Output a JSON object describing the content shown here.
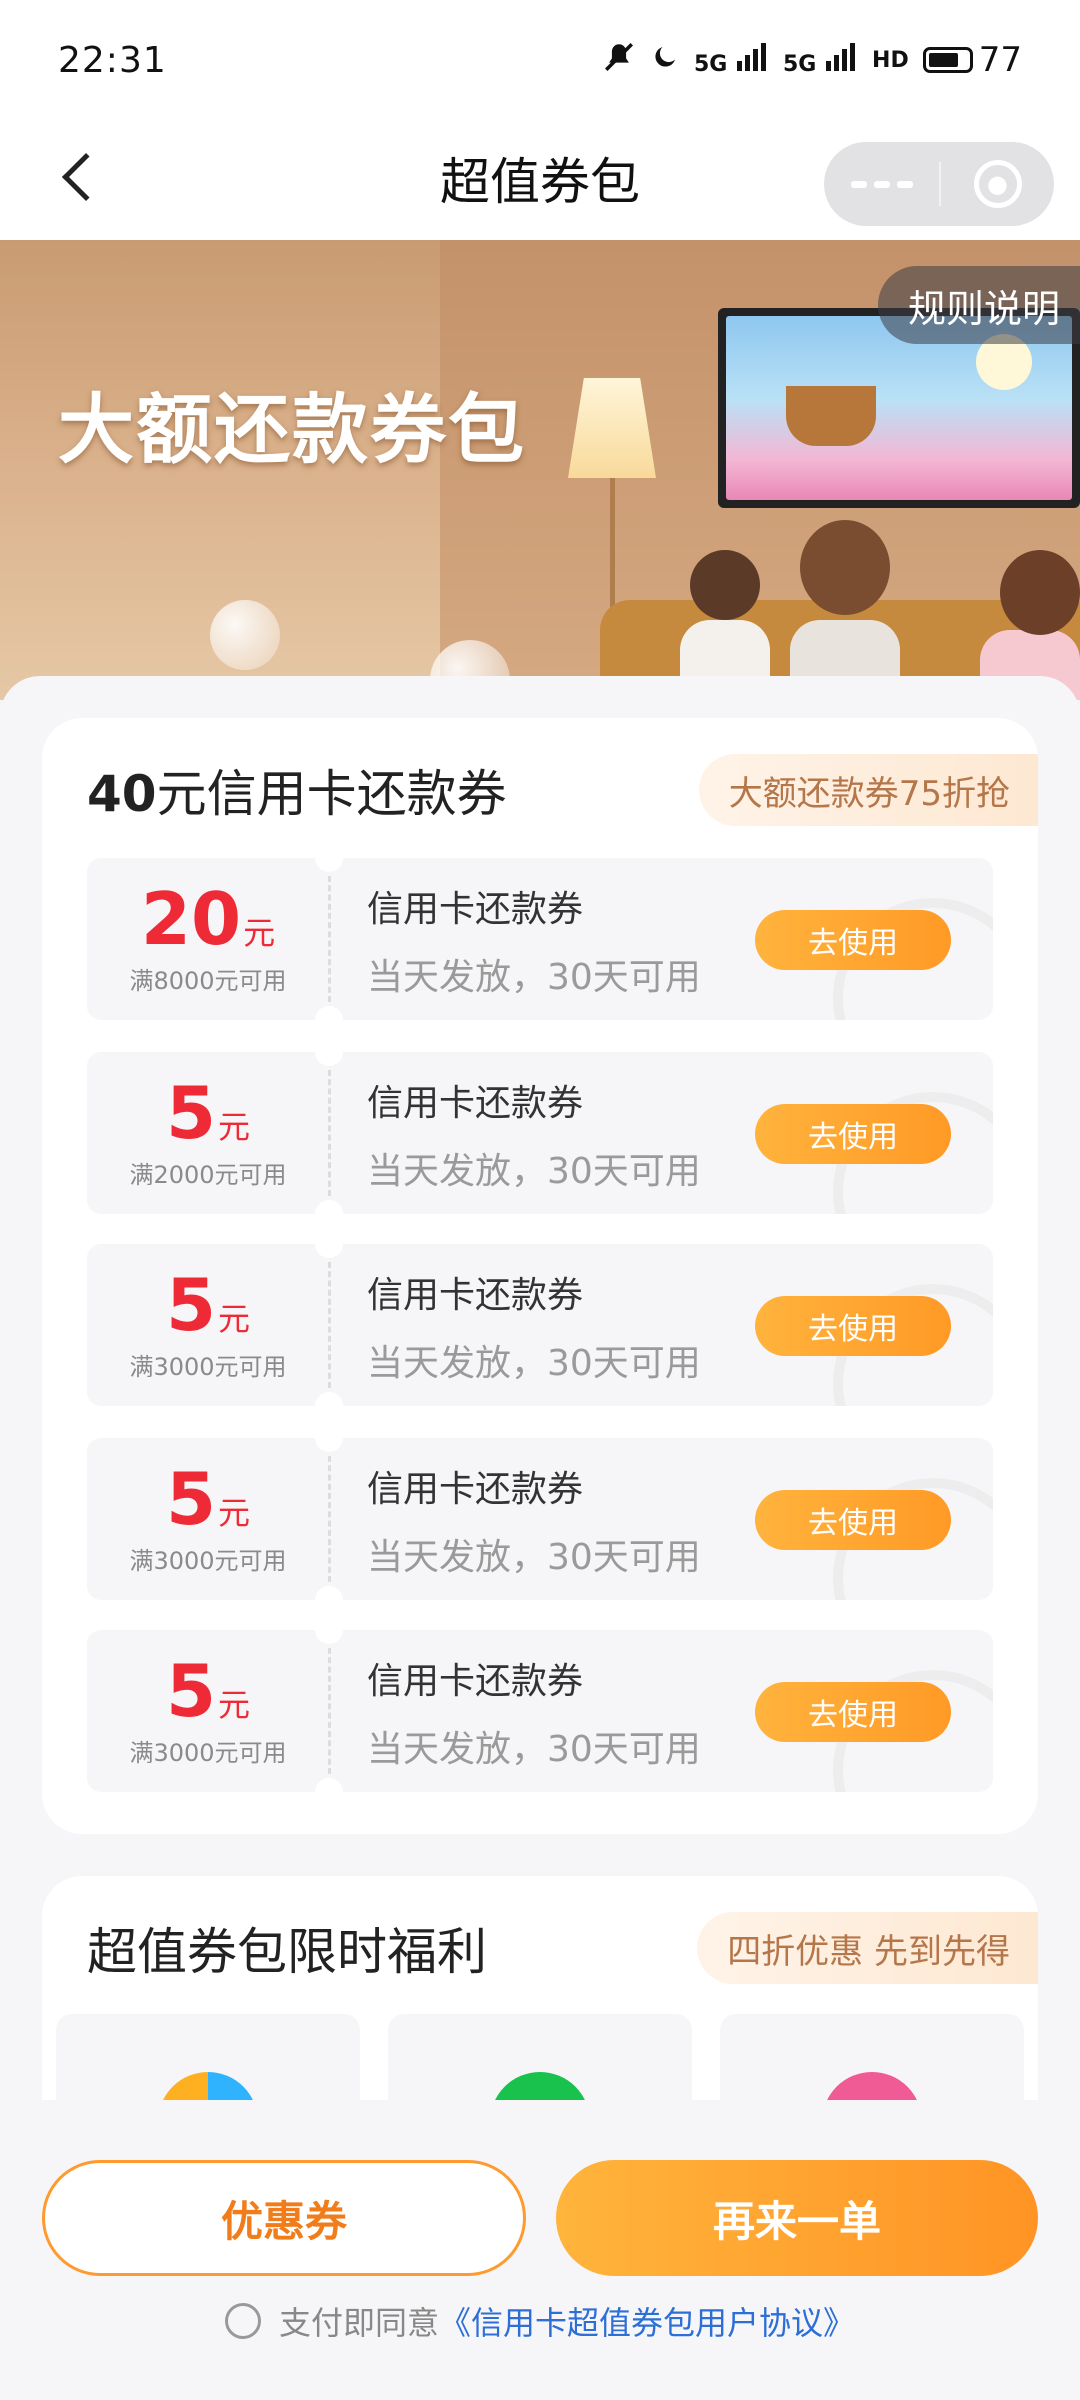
{
  "status_bar": {
    "time": "22:31",
    "icons": [
      "mute-icon",
      "moon-icon",
      "signal-5g-icon",
      "signal-5g-icon",
      "hd-icon",
      "battery-icon"
    ],
    "signal_label": "5G",
    "hd_label": "HD",
    "battery": "77"
  },
  "nav": {
    "title": "超值券包"
  },
  "banner": {
    "title": "大额还款券包",
    "rules_label": "规则说明"
  },
  "card1": {
    "title_amount": "40",
    "title_rest": "元信用卡还款券",
    "tag": "大额还款券75折抢",
    "coupons": [
      {
        "amount": "20",
        "unit": "元",
        "condition": "满8000元可用",
        "name": "信用卡还款券",
        "desc": "当天发放，30天可用",
        "button": "去使用"
      },
      {
        "amount": "5",
        "unit": "元",
        "condition": "满2000元可用",
        "name": "信用卡还款券",
        "desc": "当天发放，30天可用",
        "button": "去使用"
      },
      {
        "amount": "5",
        "unit": "元",
        "condition": "满3000元可用",
        "name": "信用卡还款券",
        "desc": "当天发放，30天可用",
        "button": "去使用"
      },
      {
        "amount": "5",
        "unit": "元",
        "condition": "满3000元可用",
        "name": "信用卡还款券",
        "desc": "当天发放，30天可用",
        "button": "去使用"
      },
      {
        "amount": "5",
        "unit": "元",
        "condition": "满3000元可用",
        "name": "信用卡还款券",
        "desc": "当天发放，30天可用",
        "button": "去使用"
      }
    ]
  },
  "card2": {
    "title": "超值券包限时福利",
    "tag": "四折优惠 先到先得",
    "tiles": [
      "video-app-icon",
      "music-app-icon",
      "pink-app-icon"
    ]
  },
  "bottom": {
    "coupon_button": "优惠券",
    "reorder_button": "再来一单",
    "agree_text": "支付即同意",
    "agreement_link": "《信用卡超值券包用户协议》"
  },
  "colors": {
    "accent_orange": "#ff9a26",
    "price_red": "#ee2a36",
    "link_blue": "#2d6fd6"
  }
}
